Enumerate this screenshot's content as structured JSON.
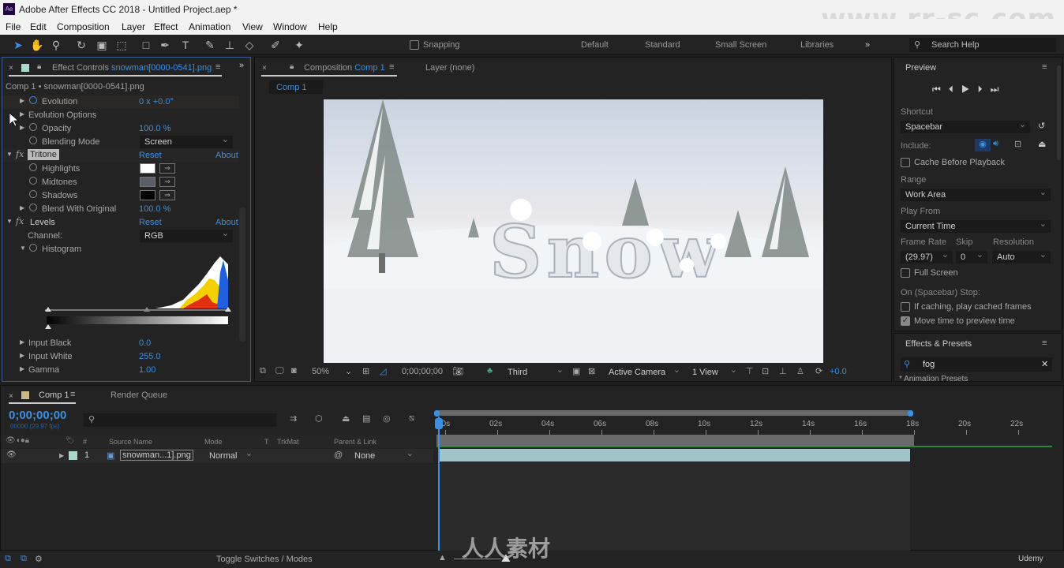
{
  "window": {
    "title": "Adobe After Effects CC 2018 - Untitled Project.aep *",
    "app_badge": "Ae",
    "watermark": "www.rr-sc.com"
  },
  "menu": [
    "File",
    "Edit",
    "Composition",
    "Layer",
    "Effect",
    "Animation",
    "View",
    "Window",
    "Help"
  ],
  "toolbar": {
    "snapping": "Snapping",
    "workspaces": [
      "Default",
      "Standard",
      "Small Screen",
      "Libraries"
    ],
    "search_placeholder": "Search Help"
  },
  "effect_controls": {
    "tab_label": "Effect Controls",
    "tab_file": "snowman[0000-0541].png",
    "breadcrumb": "Comp 1 • snowman[0000-0541].png",
    "rows": [
      {
        "label": "Evolution",
        "value": "0 x +0.0°"
      },
      {
        "label": "Evolution Options",
        "value": ""
      },
      {
        "label": "Opacity",
        "value": "100.0 %"
      },
      {
        "label": "Blending Mode",
        "value": "Screen"
      }
    ],
    "tritone": {
      "name": "Tritone",
      "reset": "Reset",
      "about": "About",
      "highlights": "Highlights",
      "midtones": "Midtones",
      "shadows": "Shadows",
      "blend": "Blend With Original",
      "blend_value": "100.0 %",
      "colors": {
        "highlights": "#ffffff",
        "midtones": "#5a5e66",
        "shadows": "#050505"
      }
    },
    "levels": {
      "name": "Levels",
      "reset": "Reset",
      "about": "About",
      "channel_label": "Channel:",
      "channel": "RGB",
      "histogram": "Histogram",
      "input_black": "Input Black",
      "input_black_value": "0.0",
      "input_white": "Input White",
      "input_white_value": "255.0",
      "gamma": "Gamma",
      "gamma_value": "1.00"
    }
  },
  "composition": {
    "tab_label": "Composition",
    "tab_comp": "Comp 1",
    "layer_tab": "Layer (none)",
    "subtab": "Comp 1",
    "footer": {
      "zoom": "50%",
      "timecode": "0;00;00;00",
      "resolution": "Third",
      "camera": "Active Camera",
      "views": "1 View",
      "exposure": "+0.0"
    }
  },
  "preview": {
    "title": "Preview",
    "shortcut_label": "Shortcut",
    "shortcut": "Spacebar",
    "include_label": "Include:",
    "cache_before": "Cache Before Playback",
    "range_label": "Range",
    "range": "Work Area",
    "play_from_label": "Play From",
    "play_from": "Current Time",
    "frame_rate_label": "Frame Rate",
    "frame_rate": "(29.97)",
    "skip_label": "Skip",
    "skip": "0",
    "resolution_label": "Resolution",
    "resolution": "Auto",
    "full_screen": "Full Screen",
    "stop_label": "On (Spacebar) Stop:",
    "if_caching": "If caching, play cached frames",
    "move_time": "Move time to preview time",
    "move_time_checked": true
  },
  "effects_presets": {
    "title": "Effects & Presets",
    "search": "fog",
    "first_item": "* Animation Presets"
  },
  "timeline": {
    "tab": "Comp 1",
    "render_queue": "Render Queue",
    "timecode": "0;00;00;00",
    "frame_info": "00000 (29.97 fps)",
    "columns": {
      "source": "Source Name",
      "mode": "Mode",
      "t": "T",
      "trkmat": "TrkMat",
      "parent": "Parent & Link",
      "num": "#"
    },
    "layer": {
      "number": "1",
      "name": "snowman...1].png",
      "mode": "Normal",
      "parent": "None"
    },
    "ticks": [
      "00s",
      "02s",
      "04s",
      "06s",
      "08s",
      "10s",
      "12s",
      "14s",
      "16s",
      "18s",
      "20s",
      "22s"
    ],
    "work_area_end_seconds": 18.1,
    "toggle": "Toggle Switches / Modes"
  },
  "bottom_logo": "人人素材",
  "udemy": "Udemy"
}
